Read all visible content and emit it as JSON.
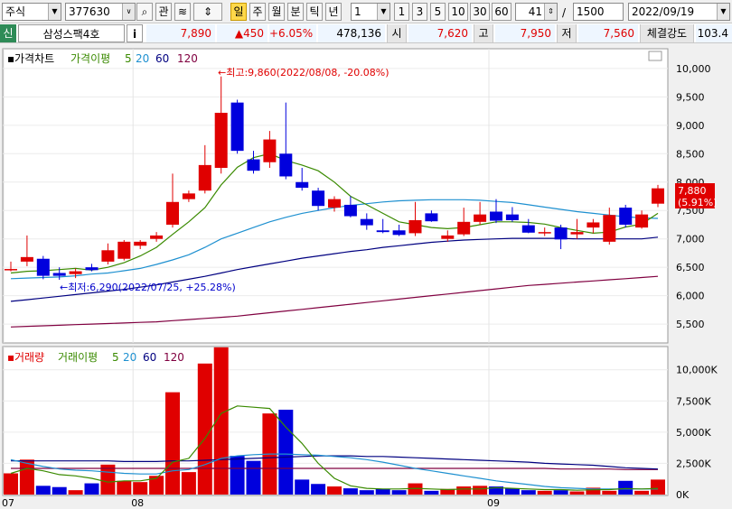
{
  "toolbar": {
    "market": "주식",
    "code": "377630",
    "btn_gwan": "관",
    "period_day": "일",
    "period_week": "주",
    "period_month": "월",
    "period_quarter": "분",
    "period_tick": "틱",
    "period_year": "년",
    "interval_value": "1",
    "intervals": [
      "1",
      "3",
      "5",
      "10",
      "30",
      "60"
    ],
    "count_value": "41",
    "count_sep": "/",
    "count_total": "1500",
    "date": "2022/09/19"
  },
  "quote": {
    "credit_tag": "신",
    "name": "삼성스팩4호",
    "info_btn": "i",
    "price": "7,890",
    "change": "▲450",
    "change_pct": "+6.05%",
    "volume": "478,136",
    "open_label": "시",
    "open": "7,620",
    "high_label": "고",
    "high": "7,950",
    "low_label": "저",
    "low": "7,560",
    "strength_label": "체결강도",
    "strength": "103.4"
  },
  "price_panel": {
    "title": "가격차트",
    "ma_label": "가격이평",
    "ma_periods": [
      "5",
      "20",
      "60",
      "120"
    ],
    "high_annotation": "←최고:9,860(2022/08/08, -20.08%)",
    "low_annotation": "←최저:6,290(2022/07/25, +25.28%)",
    "current_price": "7,880",
    "current_pct": "(5.91%)"
  },
  "volume_panel": {
    "title": "거래량",
    "ma_label": "거래이평",
    "ma_periods": [
      "5",
      "20",
      "60",
      "120"
    ]
  },
  "colors": {
    "up": "#e00000",
    "down": "#0000dd",
    "ma5": "#3a8a00",
    "ma20": "#1e90d0",
    "ma60": "#000080",
    "ma120": "#800040"
  },
  "chart_data": {
    "type": "candlestick",
    "x_tick_labels": [
      "07",
      "08",
      "09"
    ],
    "x_tick_index": [
      0,
      8,
      30
    ],
    "price_axis": {
      "ticks": [
        5500,
        6000,
        6500,
        7000,
        7500,
        8000,
        8500,
        9000,
        9500,
        10000
      ],
      "range": [
        5200,
        10300
      ]
    },
    "volume_axis": {
      "ticks": [
        0,
        2500,
        5000,
        7500,
        10000
      ],
      "tick_labels": [
        "0K",
        "2,500K",
        "5,000K",
        "7,500K",
        "10,000K"
      ],
      "range": [
        0,
        11500
      ]
    },
    "candles": [
      {
        "o": 6450,
        "h": 6600,
        "l": 6430,
        "c": 6470
      },
      {
        "o": 6600,
        "h": 7060,
        "l": 6520,
        "c": 6680
      },
      {
        "o": 6650,
        "h": 6700,
        "l": 6290,
        "c": 6350
      },
      {
        "o": 6400,
        "h": 6500,
        "l": 6280,
        "c": 6350
      },
      {
        "o": 6380,
        "h": 6480,
        "l": 6310,
        "c": 6430
      },
      {
        "o": 6500,
        "h": 6560,
        "l": 6430,
        "c": 6450
      },
      {
        "o": 6600,
        "h": 6920,
        "l": 6550,
        "c": 6800
      },
      {
        "o": 6650,
        "h": 6980,
        "l": 6620,
        "c": 6950
      },
      {
        "o": 6880,
        "h": 6980,
        "l": 6820,
        "c": 6950
      },
      {
        "o": 7000,
        "h": 7120,
        "l": 6950,
        "c": 7060
      },
      {
        "o": 7250,
        "h": 8150,
        "l": 7200,
        "c": 7650
      },
      {
        "o": 7700,
        "h": 7850,
        "l": 7650,
        "c": 7800
      },
      {
        "o": 7850,
        "h": 8650,
        "l": 7800,
        "c": 8300
      },
      {
        "o": 8250,
        "h": 9860,
        "l": 8150,
        "c": 9220
      },
      {
        "o": 9400,
        "h": 9450,
        "l": 8500,
        "c": 8550
      },
      {
        "o": 8400,
        "h": 8550,
        "l": 8150,
        "c": 8200
      },
      {
        "o": 8350,
        "h": 8900,
        "l": 8250,
        "c": 8750
      },
      {
        "o": 8500,
        "h": 9400,
        "l": 8050,
        "c": 8100
      },
      {
        "o": 8000,
        "h": 8250,
        "l": 7850,
        "c": 7900
      },
      {
        "o": 7850,
        "h": 7900,
        "l": 7500,
        "c": 7580
      },
      {
        "o": 7550,
        "h": 7750,
        "l": 7480,
        "c": 7700
      },
      {
        "o": 7600,
        "h": 7750,
        "l": 7380,
        "c": 7400
      },
      {
        "o": 7350,
        "h": 7450,
        "l": 7160,
        "c": 7240
      },
      {
        "o": 7150,
        "h": 7350,
        "l": 7100,
        "c": 7120
      },
      {
        "o": 7150,
        "h": 7250,
        "l": 7050,
        "c": 7070
      },
      {
        "o": 7100,
        "h": 7650,
        "l": 7050,
        "c": 7330
      },
      {
        "o": 7450,
        "h": 7500,
        "l": 7300,
        "c": 7310
      },
      {
        "o": 7000,
        "h": 7150,
        "l": 6950,
        "c": 7060
      },
      {
        "o": 7080,
        "h": 7550,
        "l": 7050,
        "c": 7300
      },
      {
        "o": 7300,
        "h": 7650,
        "l": 7250,
        "c": 7430
      },
      {
        "o": 7480,
        "h": 7700,
        "l": 7280,
        "c": 7320
      },
      {
        "o": 7430,
        "h": 7560,
        "l": 7300,
        "c": 7330
      },
      {
        "o": 7240,
        "h": 7350,
        "l": 7100,
        "c": 7110
      },
      {
        "o": 7100,
        "h": 7200,
        "l": 7050,
        "c": 7120
      },
      {
        "o": 7200,
        "h": 7250,
        "l": 6820,
        "c": 6990
      },
      {
        "o": 7080,
        "h": 7350,
        "l": 7000,
        "c": 7120
      },
      {
        "o": 7200,
        "h": 7350,
        "l": 7100,
        "c": 7290
      },
      {
        "o": 6950,
        "h": 7550,
        "l": 6900,
        "c": 7420
      },
      {
        "o": 7550,
        "h": 7600,
        "l": 7200,
        "c": 7250
      },
      {
        "o": 7200,
        "h": 7500,
        "l": 7180,
        "c": 7430
      },
      {
        "o": 7620,
        "h": 7950,
        "l": 7560,
        "c": 7890
      }
    ],
    "volumes": [
      1700,
      2800,
      700,
      600,
      350,
      900,
      2400,
      1100,
      1000,
      1500,
      8200,
      1800,
      10500,
      11800,
      3100,
      2700,
      6500,
      6800,
      1200,
      850,
      650,
      500,
      350,
      450,
      350,
      900,
      300,
      450,
      650,
      700,
      650,
      500,
      350,
      300,
      350,
      250,
      550,
      300,
      1100,
      300,
      1200
    ],
    "volume_ma5": [
      1700,
      2100,
      1900,
      1600,
      1500,
      1300,
      1000,
      1100,
      1100,
      1300,
      2600,
      2900,
      4500,
      6500,
      7100,
      7000,
      6900,
      5400,
      4100,
      2500,
      1300,
      700,
      500,
      450,
      450,
      500,
      450,
      400,
      450,
      450,
      550,
      500,
      450,
      400,
      400,
      350,
      380,
      400,
      480,
      450,
      500
    ],
    "volume_ma20": [
      2800,
      2500,
      2250,
      2050,
      1950,
      1900,
      1800,
      1700,
      1650,
      1650,
      1900,
      2000,
      2400,
      2900,
      3100,
      3200,
      3250,
      3250,
      3200,
      3150,
      3050,
      2950,
      2800,
      2600,
      2350,
      2100,
      1900,
      1700,
      1500,
      1300,
      1100,
      950,
      800,
      650,
      550,
      500,
      450,
      450,
      450,
      450,
      450
    ],
    "volume_ma60": [
      2700,
      2700,
      2700,
      2700,
      2700,
      2700,
      2700,
      2650,
      2650,
      2650,
      2700,
      2700,
      2750,
      2800,
      2850,
      2900,
      2950,
      3000,
      3050,
      3100,
      3100,
      3100,
      3050,
      3050,
      3000,
      2950,
      2900,
      2850,
      2800,
      2750,
      2700,
      2650,
      2600,
      2500,
      2450,
      2400,
      2350,
      2250,
      2150,
      2100,
      2050
    ],
    "volume_ma120": [
      2100,
      2100,
      2100,
      2100,
      2100,
      2100,
      2100,
      2100,
      2100,
      2100,
      2100,
      2100,
      2100,
      2100,
      2100,
      2100,
      2100,
      2100,
      2100,
      2100,
      2100,
      2100,
      2100,
      2100,
      2100,
      2100,
      2100,
      2100,
      2100,
      2100,
      2100,
      2100,
      2100,
      2100,
      2050,
      2050,
      2050,
      2050,
      2000,
      2000,
      2000
    ],
    "ma5": [
      6400,
      6430,
      6440,
      6460,
      6480,
      6450,
      6500,
      6580,
      6700,
      6850,
      7080,
      7300,
      7550,
      7950,
      8260,
      8430,
      8500,
      8380,
      8300,
      8200,
      8000,
      7750,
      7600,
      7450,
      7300,
      7250,
      7200,
      7180,
      7200,
      7250,
      7300,
      7300,
      7290,
      7260,
      7200,
      7150,
      7100,
      7120,
      7210,
      7260,
      7450
    ],
    "ma20": [
      6300,
      6310,
      6320,
      6330,
      6350,
      6380,
      6400,
      6440,
      6480,
      6550,
      6630,
      6720,
      6850,
      7000,
      7100,
      7200,
      7300,
      7380,
      7450,
      7500,
      7550,
      7590,
      7620,
      7650,
      7670,
      7680,
      7690,
      7690,
      7690,
      7680,
      7660,
      7640,
      7600,
      7560,
      7520,
      7480,
      7450,
      7420,
      7390,
      7370,
      7360
    ],
    "ma60": [
      5900,
      5930,
      5960,
      5990,
      6020,
      6050,
      6080,
      6110,
      6150,
      6190,
      6240,
      6290,
      6340,
      6400,
      6460,
      6510,
      6560,
      6610,
      6660,
      6700,
      6740,
      6780,
      6810,
      6850,
      6880,
      6910,
      6940,
      6960,
      6980,
      6990,
      7000,
      7010,
      7010,
      7010,
      7010,
      7000,
      7000,
      7000,
      7000,
      7000,
      7030
    ],
    "ma120": [
      5450,
      5460,
      5470,
      5480,
      5490,
      5500,
      5510,
      5520,
      5530,
      5540,
      5560,
      5580,
      5600,
      5620,
      5640,
      5670,
      5700,
      5730,
      5760,
      5790,
      5820,
      5850,
      5880,
      5910,
      5940,
      5970,
      6000,
      6030,
      6060,
      6090,
      6120,
      6150,
      6180,
      6200,
      6220,
      6240,
      6260,
      6280,
      6300,
      6320,
      6340
    ]
  }
}
